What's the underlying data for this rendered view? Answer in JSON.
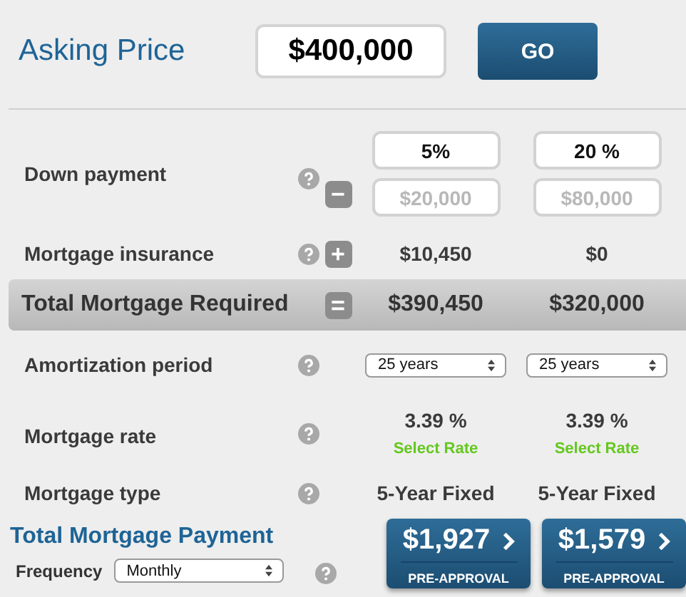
{
  "asking_price": {
    "label": "Asking Price",
    "value": "$400,000",
    "button": "GO"
  },
  "rows": [
    {
      "kind": "inputs",
      "label": "Down payment",
      "sign": "−",
      "cells": [
        {
          "value": "5%",
          "placeholder": "$20,000"
        },
        {
          "value": "20 %",
          "placeholder": "$80,000"
        }
      ]
    },
    {
      "kind": "values",
      "label": "Mortgage insurance",
      "sign": "+",
      "cells": [
        {
          "value": "$10,450"
        },
        {
          "value": "$0"
        }
      ]
    },
    {
      "kind": "total",
      "label": "Total Mortgage Required",
      "sign": "=",
      "cells": [
        {
          "value": "$390,450"
        },
        {
          "value": "$320,000"
        }
      ]
    },
    {
      "kind": "select",
      "label": "Amortization period",
      "cells": [
        {
          "value": "25 years"
        },
        {
          "value": "25 years"
        }
      ]
    },
    {
      "kind": "rate",
      "label": "Mortgage rate",
      "cells": [
        {
          "value": "3.39 %",
          "link": "Select Rate"
        },
        {
          "value": "3.39 %",
          "link": "Select Rate"
        }
      ]
    },
    {
      "kind": "values",
      "label": "Mortgage type",
      "cells": [
        {
          "value": "5-Year Fixed"
        },
        {
          "value": "5-Year Fixed"
        }
      ]
    }
  ],
  "payment": {
    "title": "Total Mortgage Payment",
    "frequency_label": "Frequency",
    "frequency": "Monthly",
    "buttons": [
      {
        "amount": "$1,927",
        "caption": "PRE-APPROVAL"
      },
      {
        "amount": "$1,579",
        "caption": "PRE-APPROVAL"
      }
    ]
  }
}
